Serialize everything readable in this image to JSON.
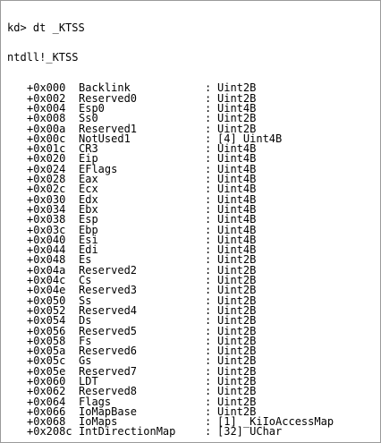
{
  "command": {
    "prompt": "kd>",
    "text": "dt _KTSS"
  },
  "struct_name": "ntdll!_KTSS",
  "fields": [
    {
      "offset": "+0x000",
      "name": "Backlink",
      "type": "Uint2B"
    },
    {
      "offset": "+0x002",
      "name": "Reserved0",
      "type": "Uint2B"
    },
    {
      "offset": "+0x004",
      "name": "Esp0",
      "type": "Uint4B"
    },
    {
      "offset": "+0x008",
      "name": "Ss0",
      "type": "Uint2B"
    },
    {
      "offset": "+0x00a",
      "name": "Reserved1",
      "type": "Uint2B"
    },
    {
      "offset": "+0x00c",
      "name": "NotUsed1",
      "type": "[4] Uint4B"
    },
    {
      "offset": "+0x01c",
      "name": "CR3",
      "type": "Uint4B"
    },
    {
      "offset": "+0x020",
      "name": "Eip",
      "type": "Uint4B"
    },
    {
      "offset": "+0x024",
      "name": "EFlags",
      "type": "Uint4B"
    },
    {
      "offset": "+0x028",
      "name": "Eax",
      "type": "Uint4B"
    },
    {
      "offset": "+0x02c",
      "name": "Ecx",
      "type": "Uint4B"
    },
    {
      "offset": "+0x030",
      "name": "Edx",
      "type": "Uint4B"
    },
    {
      "offset": "+0x034",
      "name": "Ebx",
      "type": "Uint4B"
    },
    {
      "offset": "+0x038",
      "name": "Esp",
      "type": "Uint4B"
    },
    {
      "offset": "+0x03c",
      "name": "Ebp",
      "type": "Uint4B"
    },
    {
      "offset": "+0x040",
      "name": "Esi",
      "type": "Uint4B"
    },
    {
      "offset": "+0x044",
      "name": "Edi",
      "type": "Uint4B"
    },
    {
      "offset": "+0x048",
      "name": "Es",
      "type": "Uint2B"
    },
    {
      "offset": "+0x04a",
      "name": "Reserved2",
      "type": "Uint2B"
    },
    {
      "offset": "+0x04c",
      "name": "Cs",
      "type": "Uint2B"
    },
    {
      "offset": "+0x04e",
      "name": "Reserved3",
      "type": "Uint2B"
    },
    {
      "offset": "+0x050",
      "name": "Ss",
      "type": "Uint2B"
    },
    {
      "offset": "+0x052",
      "name": "Reserved4",
      "type": "Uint2B"
    },
    {
      "offset": "+0x054",
      "name": "Ds",
      "type": "Uint2B"
    },
    {
      "offset": "+0x056",
      "name": "Reserved5",
      "type": "Uint2B"
    },
    {
      "offset": "+0x058",
      "name": "Fs",
      "type": "Uint2B"
    },
    {
      "offset": "+0x05a",
      "name": "Reserved6",
      "type": "Uint2B"
    },
    {
      "offset": "+0x05c",
      "name": "Gs",
      "type": "Uint2B"
    },
    {
      "offset": "+0x05e",
      "name": "Reserved7",
      "type": "Uint2B"
    },
    {
      "offset": "+0x060",
      "name": "LDT",
      "type": "Uint2B"
    },
    {
      "offset": "+0x062",
      "name": "Reserved8",
      "type": "Uint2B"
    },
    {
      "offset": "+0x064",
      "name": "Flags",
      "type": "Uint2B"
    },
    {
      "offset": "+0x066",
      "name": "IoMapBase",
      "type": "Uint2B"
    },
    {
      "offset": "+0x068",
      "name": "IoMaps",
      "type": "[1] _KiIoAccessMap"
    },
    {
      "offset": "+0x208c",
      "name": "IntDirectionMap",
      "type": "[32] UChar"
    }
  ]
}
